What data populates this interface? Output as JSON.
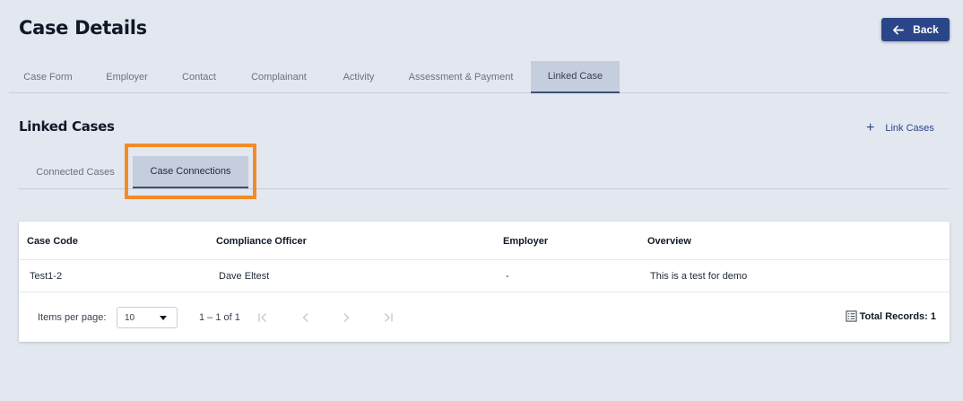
{
  "header": {
    "title": "Case Details",
    "back_label": "Back"
  },
  "main_tabs": [
    {
      "label": "Case Form"
    },
    {
      "label": "Employer"
    },
    {
      "label": "Contact"
    },
    {
      "label": "Complainant"
    },
    {
      "label": "Activity"
    },
    {
      "label": "Assessment & Payment"
    },
    {
      "label": "Linked Case",
      "active": true
    }
  ],
  "section": {
    "title": "Linked Cases",
    "link_label": "Link Cases"
  },
  "sub_tabs": [
    {
      "label": "Connected Cases"
    },
    {
      "label": "Case Connections",
      "active": true
    }
  ],
  "table": {
    "headers": [
      "Case Code",
      "Compliance Officer",
      "Employer",
      "Overview"
    ],
    "rows": [
      [
        "Test1-2",
        "Dave Eltest",
        "-",
        "This is a test for demo"
      ]
    ]
  },
  "paginator": {
    "items_label": "Items per page:",
    "page_size": "10",
    "range": "1 – 1 of 1",
    "total": "Total Records: 1"
  },
  "colors": {
    "primary": "#2b4589",
    "background": "#e2e7f0",
    "active_tab": "#c5cedd",
    "highlight": "#f28c28"
  }
}
